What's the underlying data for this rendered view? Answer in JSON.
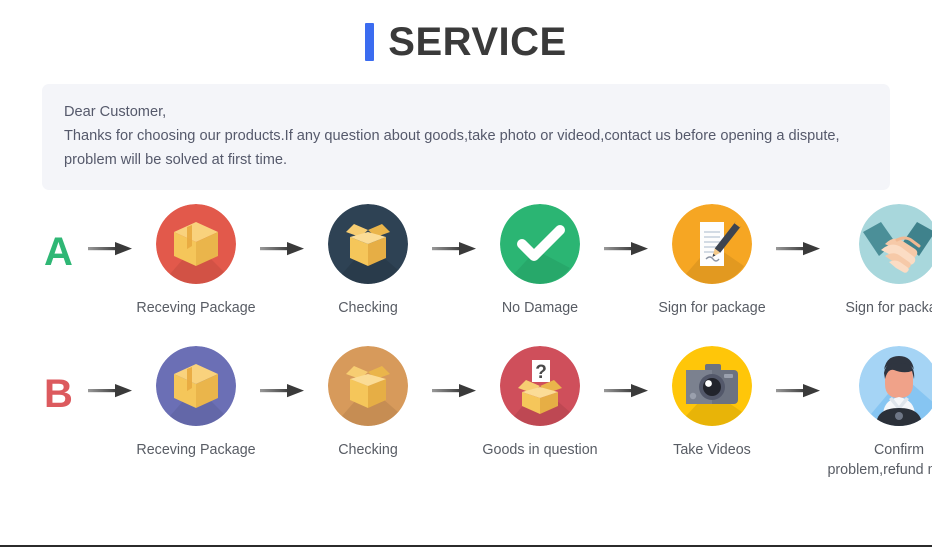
{
  "header": {
    "title": "SERVICE",
    "accent_color": "#3b6cf0"
  },
  "note": {
    "lines": [
      "Dear Customer,",
      "Thanks for choosing our products.If any question about goods,take photo or videod,contact us before opening a dispute,",
      "problem will be solved at first time."
    ],
    "background_color": "#f4f5f9",
    "text_color": "#55596b"
  },
  "flows": [
    {
      "letter": "A",
      "letter_color": "#2fb775",
      "steps": [
        {
          "label": "Receving Package",
          "icon": "package-box-icon",
          "circle_color": "#e2594b"
        },
        {
          "label": "Checking",
          "icon": "open-box-icon",
          "circle_color": "#2e4254"
        },
        {
          "label": "No Damage",
          "icon": "check-mark-icon",
          "circle_color": "#2bb573"
        },
        {
          "label": "Sign for package",
          "icon": "document-pen-icon",
          "circle_color": "#f6a623"
        },
        {
          "label": "Sign for package",
          "icon": "handshake-icon",
          "circle_color": "#a8d7dc"
        }
      ]
    },
    {
      "letter": "B",
      "letter_color": "#dc5a5e",
      "steps": [
        {
          "label": "Receving Package",
          "icon": "package-box-icon",
          "circle_color": "#6b6fb5"
        },
        {
          "label": "Checking",
          "icon": "open-box-icon",
          "circle_color": "#d79a5b"
        },
        {
          "label": "Goods in question",
          "icon": "question-box-icon",
          "circle_color": "#cf4f5b"
        },
        {
          "label": "Take Videos",
          "icon": "camera-icon",
          "circle_color": "#ffc609"
        },
        {
          "label": "Confirm problem,refund money",
          "icon": "support-person-icon",
          "circle_color": "#a5d4f5"
        }
      ]
    }
  ],
  "arrow": {
    "icon": "arrow-right-icon",
    "color": "#4b4b4b"
  }
}
